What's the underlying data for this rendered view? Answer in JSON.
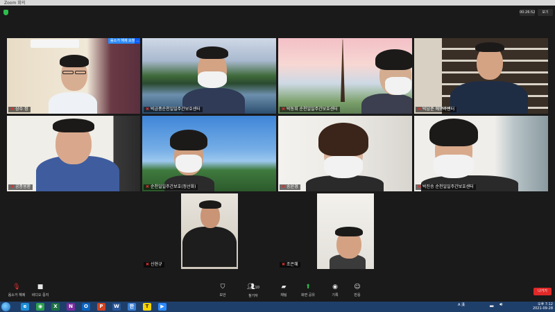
{
  "window": {
    "title": "Zoom 회의"
  },
  "header": {
    "timer": "00:26:52",
    "view_label": "보기"
  },
  "participants": [
    {
      "name": "상수 정",
      "ribbon": "음소거 해제 요청",
      "ribbon_more": "..."
    },
    {
      "name": "박금종순천일일주간보호센터"
    },
    {
      "name": "박동희 순천일일주간보호센터"
    },
    {
      "name": "박남준 예뽀라센터"
    },
    {
      "name": "공종용환"
    },
    {
      "name": "순천일일주간보호(정선화)"
    },
    {
      "name": "송윤경"
    },
    {
      "name": "박진승 순천일일주간보호센터"
    },
    {
      "name": "신현규"
    },
    {
      "name": "조은혜"
    }
  ],
  "toolbar": {
    "unmute": "음소거 해제",
    "video": "비디오 중지",
    "security": "보안",
    "participants": "참가자",
    "participants_count": "10",
    "chat": "채팅",
    "share": "화면 공유",
    "record": "기록",
    "reactions": "반응",
    "leave": "나가기"
  },
  "taskbar": {
    "time": "오후 7:12",
    "date": "2021-09-28",
    "ime": "A 漢",
    "apps": [
      {
        "icon": "ie-icon",
        "glyph": "e",
        "color": "#1e8fd6"
      },
      {
        "icon": "chrome-icon",
        "glyph": "◉",
        "color": "#2ba24c"
      },
      {
        "icon": "excel-icon",
        "glyph": "X",
        "color": "#1d7044"
      },
      {
        "icon": "onenote-icon",
        "glyph": "N",
        "color": "#7b2ca0"
      },
      {
        "icon": "outlook-icon",
        "glyph": "O",
        "color": "#0c64c0"
      },
      {
        "icon": "powerpoint-icon",
        "glyph": "P",
        "color": "#d04423"
      },
      {
        "icon": "word-icon",
        "glyph": "W",
        "color": "#2b579a"
      },
      {
        "icon": "hangul-icon",
        "glyph": "한",
        "color": "#3a7fd4"
      },
      {
        "icon": "kakaotalk-icon",
        "glyph": "T",
        "color": "#f7d600"
      },
      {
        "icon": "zoom-icon",
        "glyph": "▶",
        "color": "#2d8cff"
      }
    ]
  }
}
